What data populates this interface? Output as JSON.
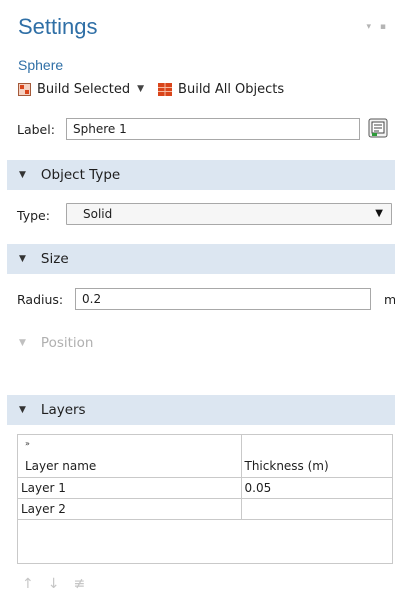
{
  "header": {
    "title": "Settings",
    "subtitle": "Sphere"
  },
  "toolbar": {
    "build_selected": "Build Selected",
    "build_all": "Build All Objects"
  },
  "label_field": {
    "label": "Label:",
    "value": "Sphere 1"
  },
  "sections": {
    "object_type": "Object Type",
    "size": "Size",
    "position": "Position",
    "layers": "Layers"
  },
  "object_type": {
    "type_label": "Type:",
    "type_value": "Solid"
  },
  "size": {
    "radius_label": "Radius:",
    "radius_value": "0.2",
    "unit": "m"
  },
  "layers_table": {
    "columns": [
      "Layer name",
      "Thickness (m)"
    ],
    "rows": [
      {
        "name": "Layer 1",
        "thickness": "0.05"
      },
      {
        "name": "Layer 2",
        "thickness": ""
      }
    ]
  },
  "icons": {
    "build_selected": "build-selected-icon",
    "build_all": "build-all-icon",
    "label_action": "label-edit-icon",
    "move_up": "arrow-up-icon",
    "move_down": "arrow-down-icon",
    "clear": "clear-table-icon"
  },
  "colors": {
    "title": "#2f6fa6",
    "section_header": "#dce6f1",
    "build_icon": "#d9451b"
  }
}
